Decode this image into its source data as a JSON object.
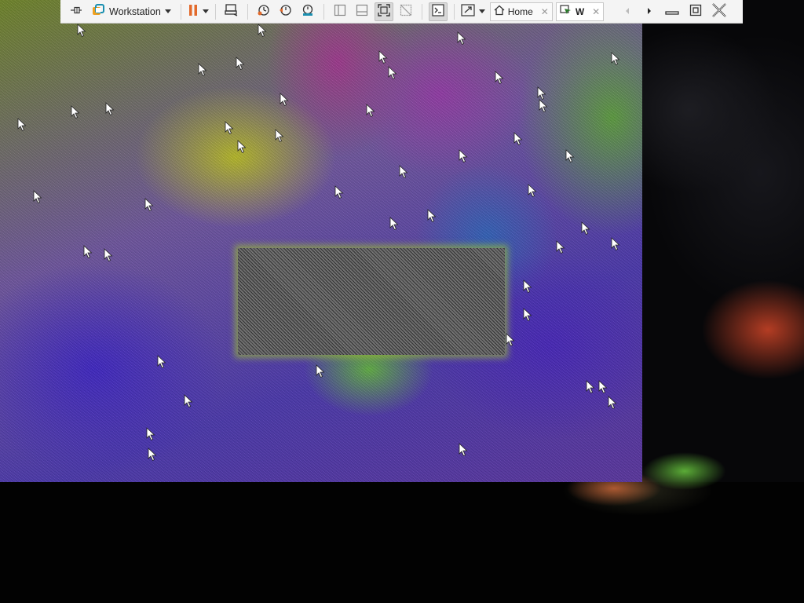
{
  "toolbar": {
    "app_menu_label": "Workstation",
    "home_tab_label": "Home",
    "vm_tab_label": "W",
    "accent_orange": "#e2692a",
    "accent_teal": "#1a8fb0"
  },
  "icons": {
    "pin": "pin-icon",
    "app_logo": "workstation-logo-icon",
    "pause": "pause-icon",
    "send_keys": "send-keys-icon",
    "snapshot_take": "snapshot-take-icon",
    "snapshot_revert": "snapshot-revert-icon",
    "snapshot_manager": "snapshot-manager-icon",
    "view_sidebar": "library-view-icon",
    "view_thumbnail": "thumbnail-bar-icon",
    "full_screen": "full-screen-icon",
    "unity": "unity-icon",
    "console": "console-view-icon",
    "stretch": "stretch-guest-icon",
    "home": "home-icon",
    "vm": "vm-tab-icon"
  }
}
